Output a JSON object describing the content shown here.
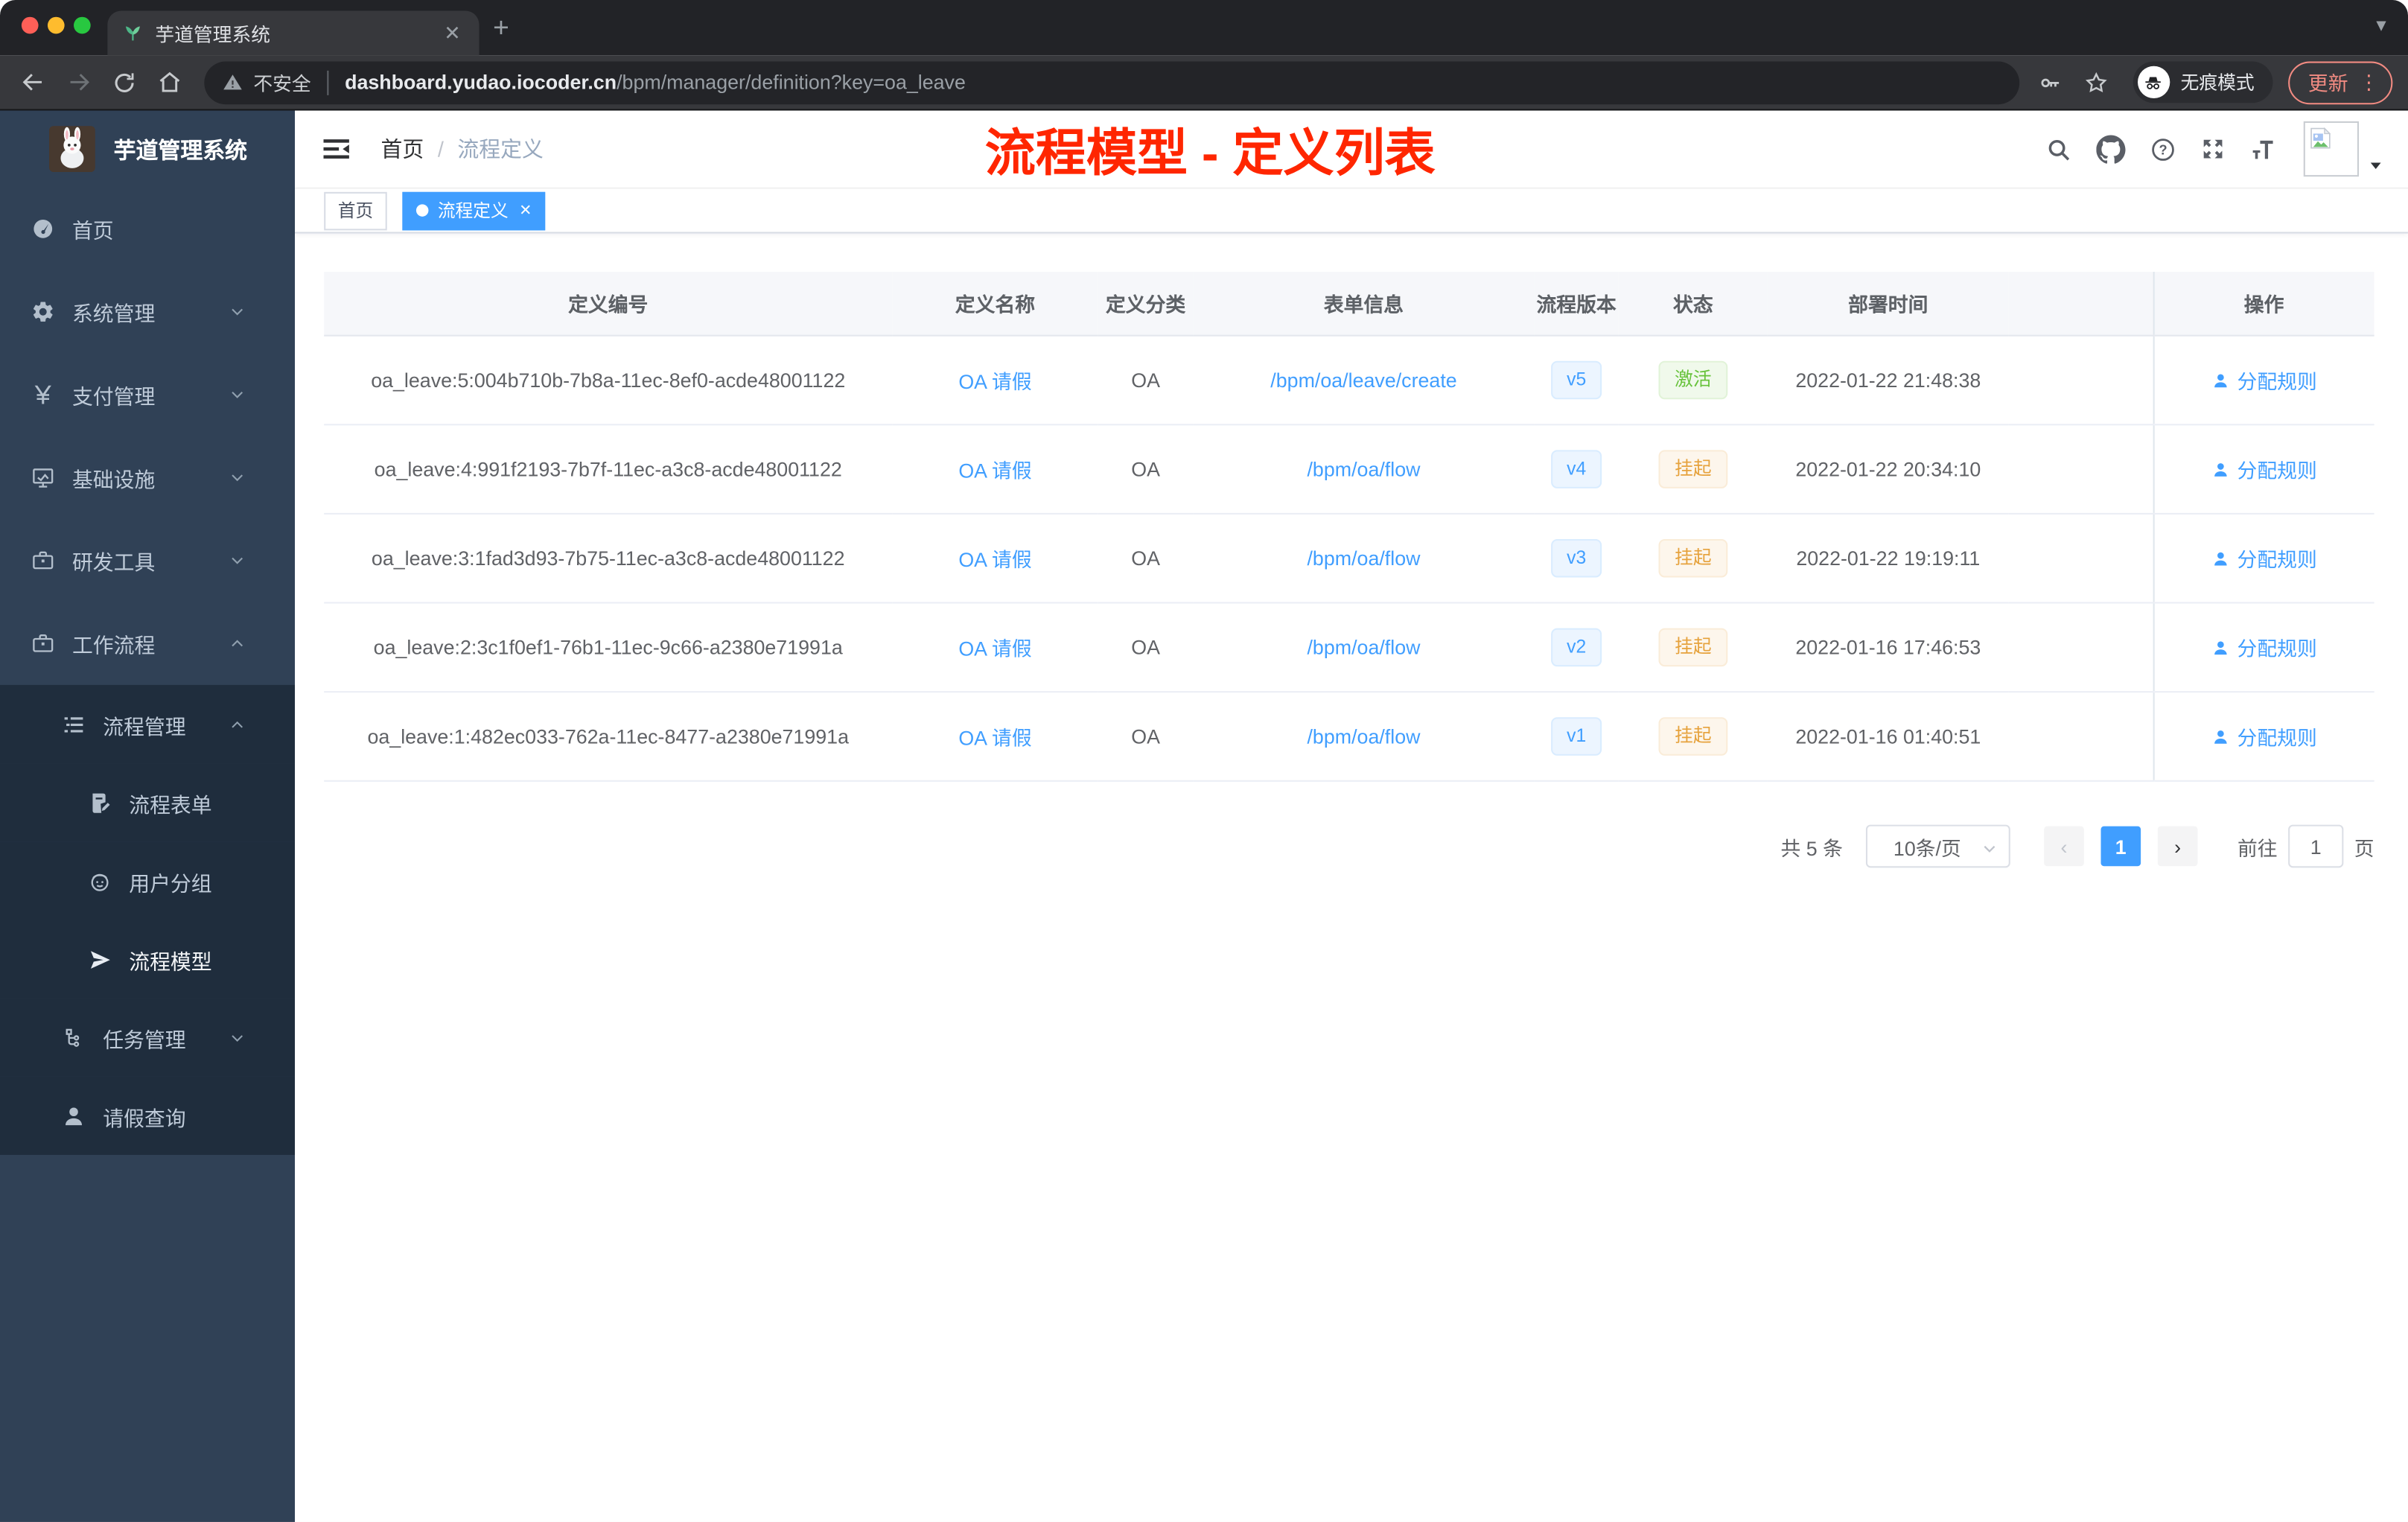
{
  "browser": {
    "tab_title": "芋道管理系统",
    "new_tab_glyph": "+",
    "security_label": "不安全",
    "url_domain": "dashboard.yudao.iocoder.cn",
    "url_path": "/bpm/manager/definition?key=oa_leave",
    "incognito_label": "无痕模式",
    "update_label": "更新"
  },
  "sidebar": {
    "logo_title": "芋道管理系统",
    "menu": [
      {
        "label": "首页",
        "icon": "dashboard",
        "level": 1
      },
      {
        "label": "系统管理",
        "icon": "gear",
        "level": 1,
        "chevron": "down"
      },
      {
        "label": "支付管理",
        "icon": "yen",
        "level": 1,
        "chevron": "down"
      },
      {
        "label": "基础设施",
        "icon": "monitor",
        "level": 1,
        "chevron": "down"
      },
      {
        "label": "研发工具",
        "icon": "toolbox",
        "level": 1,
        "chevron": "down"
      },
      {
        "label": "工作流程",
        "icon": "toolbox",
        "level": 1,
        "chevron": "up"
      },
      {
        "label": "流程管理",
        "icon": "treelist",
        "level": 2,
        "chevron": "up",
        "sub": true
      },
      {
        "label": "流程表单",
        "icon": "form",
        "level": 3,
        "sub": true
      },
      {
        "label": "用户分组",
        "icon": "face",
        "level": 3,
        "sub": true
      },
      {
        "label": "流程模型",
        "icon": "send",
        "level": 3,
        "sub": true,
        "active": true
      },
      {
        "label": "任务管理",
        "icon": "task",
        "level": 2,
        "chevron": "down",
        "sub": true
      },
      {
        "label": "请假查询",
        "icon": "user",
        "level": 2,
        "sub": true
      }
    ]
  },
  "header": {
    "breadcrumb_home": "首页",
    "breadcrumb_sep": "/",
    "breadcrumb_current": "流程定义",
    "annotation": "流程模型 - 定义列表"
  },
  "tags": [
    {
      "label": "首页",
      "active": false
    },
    {
      "label": "流程定义",
      "active": true,
      "closable": true
    }
  ],
  "table": {
    "columns": [
      "定义编号",
      "定义名称",
      "定义分类",
      "表单信息",
      "流程版本",
      "状态",
      "部署时间",
      "操作"
    ],
    "action_label": "分配规则",
    "rows": [
      {
        "id": "oa_leave:5:004b710b-7b8a-11ec-8ef0-acde48001122",
        "name": "OA 请假",
        "category": "OA",
        "form": "/bpm/oa/leave/create",
        "version": "v5",
        "status": "激活",
        "status_type": "success",
        "time": "2022-01-22 21:48:38"
      },
      {
        "id": "oa_leave:4:991f2193-7b7f-11ec-a3c8-acde48001122",
        "name": "OA 请假",
        "category": "OA",
        "form": "/bpm/oa/flow",
        "version": "v4",
        "status": "挂起",
        "status_type": "warning",
        "time": "2022-01-22 20:34:10"
      },
      {
        "id": "oa_leave:3:1fad3d93-7b75-11ec-a3c8-acde48001122",
        "name": "OA 请假",
        "category": "OA",
        "form": "/bpm/oa/flow",
        "version": "v3",
        "status": "挂起",
        "status_type": "warning",
        "time": "2022-01-22 19:19:11"
      },
      {
        "id": "oa_leave:2:3c1f0ef1-76b1-11ec-9c66-a2380e71991a",
        "name": "OA 请假",
        "category": "OA",
        "form": "/bpm/oa/flow",
        "version": "v2",
        "status": "挂起",
        "status_type": "warning",
        "time": "2022-01-16 17:46:53"
      },
      {
        "id": "oa_leave:1:482ec033-762a-11ec-8477-a2380e71991a",
        "name": "OA 请假",
        "category": "OA",
        "form": "/bpm/oa/flow",
        "version": "v1",
        "status": "挂起",
        "status_type": "warning",
        "time": "2022-01-16 01:40:51"
      }
    ]
  },
  "pagination": {
    "total": "共 5 条",
    "page_size": "10条/页",
    "current": "1",
    "goto_label": "前往",
    "goto_value": "1",
    "goto_suffix": "页"
  },
  "colors": {
    "accent": "#409eff",
    "success": "#67c23a",
    "warning": "#e6a23c",
    "annotation_red": "#ff2600",
    "sidebar_bg": "#304156",
    "submenu_bg": "#1f2d3d",
    "sidebar_text": "#bfcbd9",
    "update_red": "#f28b82"
  }
}
